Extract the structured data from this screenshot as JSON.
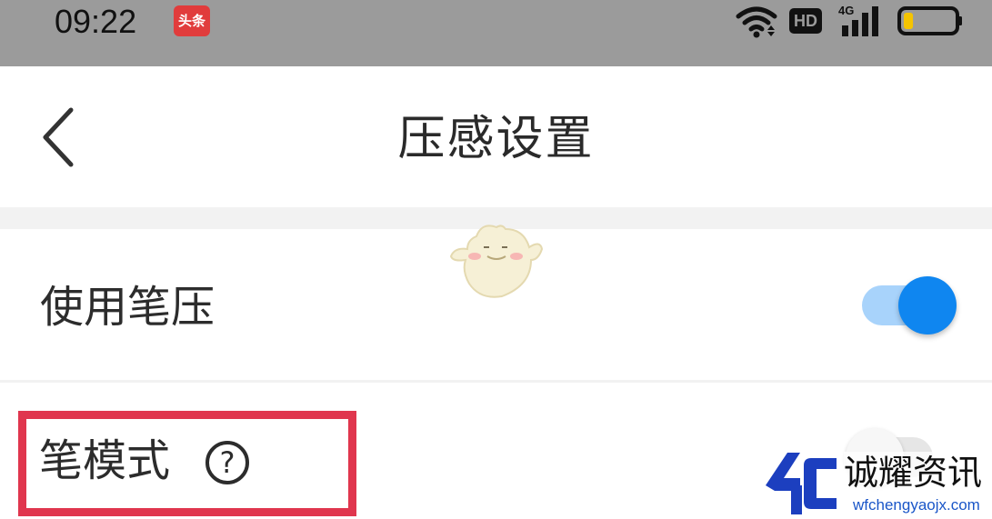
{
  "status_bar": {
    "time": "09:22",
    "app_badge": "头条",
    "hd_label": "HD",
    "network_label": "4G",
    "icons": [
      "wifi-icon",
      "hd-icon",
      "signal-4g-icon",
      "battery-low-icon"
    ],
    "battery_level": 0.15,
    "battery_color": "#f5c400"
  },
  "header": {
    "title": "压感设置",
    "back_icon": "chevron-left-icon"
  },
  "settings": [
    {
      "label": "使用笔压",
      "enabled": true
    },
    {
      "label": "笔模式",
      "enabled": false,
      "help_symbol": "?"
    }
  ],
  "colors": {
    "status_bar_bg": "#9b9b9b",
    "toggle_on": "#0f86f0",
    "toggle_on_track": "#a8d3fb",
    "highlight": "#e0364e",
    "watermark_blue": "#1a56c8"
  },
  "watermark": {
    "title": "诚耀资讯",
    "url": "wfchengyaojx.com"
  }
}
